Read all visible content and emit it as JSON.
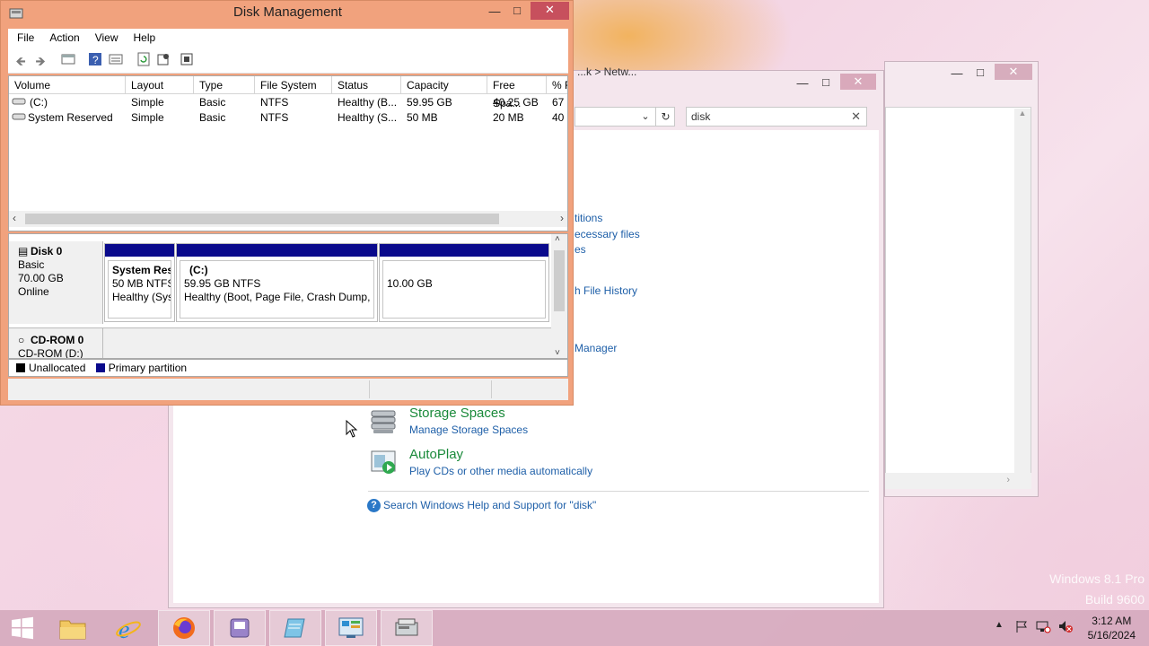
{
  "disk_management": {
    "title": "Disk Management",
    "menu": [
      "File",
      "Action",
      "View",
      "Help"
    ],
    "columns": [
      "Volume",
      "Layout",
      "Type",
      "File System",
      "Status",
      "Capacity",
      "Free Spa...",
      "% F"
    ],
    "volumes": [
      [
        "(C:)",
        "Simple",
        "Basic",
        "NTFS",
        "Healthy (B...",
        "59.95 GB",
        "40.25 GB",
        "67"
      ],
      [
        "System Reserved",
        "Simple",
        "Basic",
        "NTFS",
        "Healthy (S...",
        "50 MB",
        "20 MB",
        "40"
      ]
    ],
    "disk0": {
      "name": "Disk 0",
      "type": "Basic",
      "size": "70.00 GB",
      "state": "Online"
    },
    "partitions": [
      {
        "name": "System Res",
        "size": "50 MB NTFS",
        "status": "Healthy (Sys"
      },
      {
        "name": "(C:)",
        "size": "59.95 GB NTFS",
        "status": "Healthy (Boot, Page File, Crash Dump, P"
      },
      {
        "name": "",
        "size": "10.00 GB",
        "status": ""
      }
    ],
    "cdrom": {
      "name": "CD-ROM 0",
      "sub": "CD-ROM (D:)"
    },
    "legend": {
      "unallocated": "Unallocated",
      "primary": "Primary partition",
      "unallocated_color": "#000000",
      "primary_color": "#0a0a8c"
    }
  },
  "control_panel": {
    "search_value": "disk",
    "partial_title": "...k > Netw...",
    "partial_links": [
      "titions",
      "ecessary files",
      "es",
      "h File History",
      "Manager"
    ],
    "storage_spaces": {
      "title": "Storage Spaces",
      "link": "Manage Storage Spaces"
    },
    "autoplay": {
      "title": "AutoPlay",
      "link": "Play CDs or other media automatically"
    },
    "help_link": "Search Windows Help and Support for \"disk\""
  },
  "watermark": {
    "line1": "Windows 8.1 Pro",
    "line2": "Build 9600"
  },
  "taskbar": {
    "time": "3:12 AM",
    "date": "5/16/2024",
    "apps": [
      "start-button",
      "file-explorer",
      "internet-explorer",
      "firefox",
      "app-purple",
      "notepad",
      "control-panel",
      "disk-management"
    ]
  },
  "colors": {
    "accent_titlebar": "#f1a27d",
    "link": "#1e5fa8",
    "category_title": "#1a8a3a",
    "partition_bar": "#0a0a8c"
  }
}
